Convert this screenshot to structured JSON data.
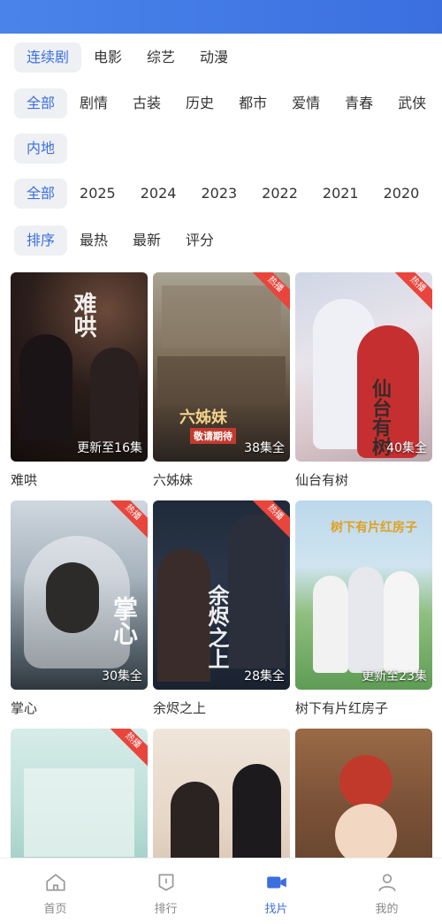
{
  "colors": {
    "accent": "#3b6fe0",
    "hot": "#e8453c"
  },
  "categories": [
    "连续剧",
    "电影",
    "综艺",
    "动漫"
  ],
  "genres": [
    "全部",
    "剧情",
    "古装",
    "历史",
    "都市",
    "爱情",
    "青春",
    "武侠"
  ],
  "regions": [
    "内地"
  ],
  "years": [
    "全部",
    "2025",
    "2024",
    "2023",
    "2022",
    "2021",
    "2020"
  ],
  "sorts": [
    "排序",
    "最热",
    "最新",
    "评分"
  ],
  "cards": [
    {
      "title": "难哄",
      "episodes": "更新至16集",
      "hot": false,
      "poster_text": "难哄"
    },
    {
      "title": "六姊妹",
      "episodes": "38集全",
      "hot": true,
      "poster_text": "六姊妹",
      "sub_text": "敬请期待"
    },
    {
      "title": "仙台有树",
      "episodes": "40集全",
      "hot": true,
      "poster_text": "仙台有树"
    },
    {
      "title": "掌心",
      "episodes": "30集全",
      "hot": true,
      "poster_text": "掌心"
    },
    {
      "title": "余烬之上",
      "episodes": "28集全",
      "hot": true,
      "poster_text": "余烬之上"
    },
    {
      "title": "树下有片红房子",
      "episodes": "更新至23集",
      "hot": false,
      "poster_text": "树下有片红房子"
    },
    {
      "title": "",
      "episodes": "",
      "hot": true,
      "poster_text": ""
    },
    {
      "title": "",
      "episodes": "",
      "hot": false,
      "poster_text": ""
    },
    {
      "title": "",
      "episodes": "",
      "hot": false,
      "poster_text": ""
    }
  ],
  "hot_label": "热播",
  "tabs": [
    {
      "label": "首页",
      "icon": "home-icon",
      "active": false
    },
    {
      "label": "排行",
      "icon": "ranking-icon",
      "active": false
    },
    {
      "label": "找片",
      "icon": "video-camera-icon",
      "active": true
    },
    {
      "label": "我的",
      "icon": "user-icon",
      "active": false
    }
  ]
}
